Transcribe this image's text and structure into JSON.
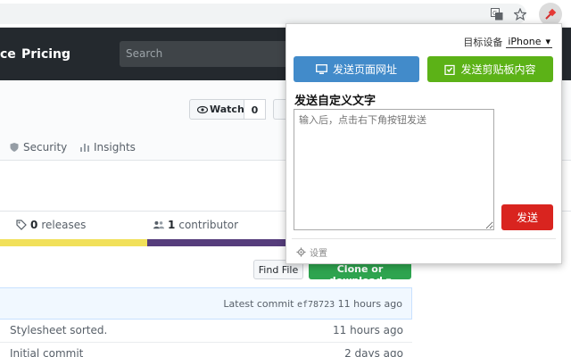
{
  "header": {
    "nav_marketplace": "ce",
    "nav_pricing": "Pricing",
    "search_placeholder": "Search"
  },
  "repo": {
    "watch_label": "Watch",
    "watch_count": "0",
    "tabs": [
      "Security",
      "Insights"
    ],
    "releases_count": "0",
    "releases_label": "releases",
    "contributors_count": "1",
    "contributors_label": "contributor",
    "languages": [
      {
        "color": "#f1e05a",
        "share": 0.5
      },
      {
        "color": "#563d7c",
        "share": 0.5
      }
    ],
    "find_file_label": "Find File",
    "clone_label": "Clone or download",
    "latest_commit_label": "Latest commit",
    "latest_commit_sha": "ef78723",
    "latest_commit_age": "11 hours ago",
    "files": [
      {
        "message": "Stylesheet sorted.",
        "age": "11 hours ago"
      },
      {
        "message": "Initial commit",
        "age": "2 days ago"
      }
    ]
  },
  "popup": {
    "device_label": "目标设备",
    "device_value": "iPhone",
    "send_url_label": "发送页面网址",
    "send_clipboard_label": "发送剪贴板内容",
    "custom_title": "发送自定义文字",
    "custom_placeholder": "输入后，点击右下角按钮发送",
    "send_label": "发送",
    "settings_label": "设置"
  },
  "colors": {
    "header_bg": "#24292e",
    "url_btn": "#428bca",
    "clip_btn": "#5cb217",
    "send_btn": "#d9241f",
    "clone_btn": "#2ea44f"
  }
}
